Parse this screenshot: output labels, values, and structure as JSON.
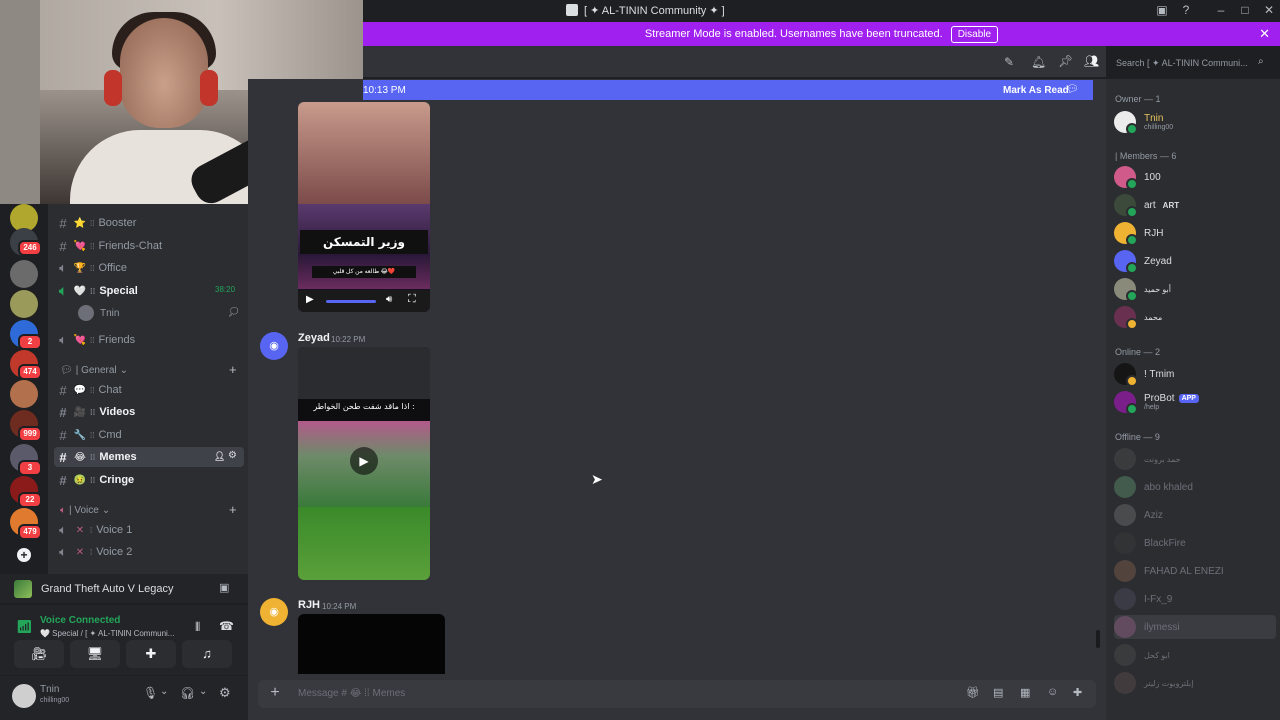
{
  "window": {
    "title": "[ ✦ AL-TININ Community ✦ ]"
  },
  "banner": {
    "text": "Streamer Mode is enabled. Usernames have been truncated.",
    "button": "Disable"
  },
  "server_rail": {
    "badges": [
      "246",
      "2",
      "474",
      "999",
      "3",
      "22",
      "479"
    ]
  },
  "channels": {
    "items_top": [
      {
        "name": "Booster",
        "emoji": "⭐",
        "type": "text"
      },
      {
        "name": "Friends-Chat",
        "emoji": "💘",
        "type": "text"
      },
      {
        "name": "Office",
        "emoji": "🏆",
        "type": "voice"
      },
      {
        "name": "Special",
        "emoji": "🤍",
        "type": "voice",
        "timer": "38:20"
      },
      {
        "name": "Friends",
        "emoji": "💘",
        "type": "voice"
      }
    ],
    "voice_user": "Tnin",
    "category_general": "| General",
    "items_general": [
      {
        "name": "Chat",
        "emoji": "💬"
      },
      {
        "name": "Videos",
        "emoji": "🎥"
      },
      {
        "name": "Cmd",
        "emoji": "🔧"
      },
      {
        "name": "Memes",
        "emoji": "😂"
      },
      {
        "name": "Cringe",
        "emoji": "🤢"
      }
    ],
    "category_voice": "| Voice",
    "items_voice": [
      {
        "name": "Voice 1"
      },
      {
        "name": "Voice 2"
      }
    ]
  },
  "activity": {
    "game": "Grand Theft Auto V Legacy"
  },
  "voice_panel": {
    "status": "Voice Connected",
    "channel": "🤍 Special / [ ✦ AL-TININ Communi..."
  },
  "user_panel": {
    "name": "Tnin",
    "status": "chilling00"
  },
  "chat": {
    "new_messages_time": "10:13 PM",
    "mark_as_read": "Mark As Read",
    "video_overlay_text": "وزير التمسكن",
    "video_caption_small": "طالعه من كل قلبي 😂❤️",
    "messages": [
      {
        "author": "Zeyad",
        "time": "10:22 PM",
        "caption": "اذا ماقد شفت طحن الخواطر :"
      },
      {
        "author": "RJH",
        "time": "10:24 PM"
      }
    ],
    "input_placeholder": "Message # 😂 ⁞⁞ Memes"
  },
  "header": {
    "search_placeholder": "Search [ ✦ AL-TININ Communi..."
  },
  "members": {
    "owner_heading": "Owner — 1",
    "owner": {
      "name": "Tnin",
      "sub": "chilling00"
    },
    "members_heading": "| Members — 6",
    "members_list": [
      "100",
      "art",
      "RJH",
      "Zeyad",
      "أبو حميد",
      "محمد"
    ],
    "art_tag": "ART",
    "online_heading": "Online — 2",
    "online_list": [
      "! Tmim",
      "ProBot"
    ],
    "probot_sub": "/help",
    "probot_tag": "APP",
    "offline_heading": "Offline — 9",
    "offline_list": [
      "حمد برونت",
      "abo khaled",
      "Aziz",
      "BlackFire",
      "FAHAD AL ENEZI",
      "I-Fx_9",
      "ilymessi",
      "ابو كحل",
      "إبلتروبوت زليتر"
    ]
  }
}
